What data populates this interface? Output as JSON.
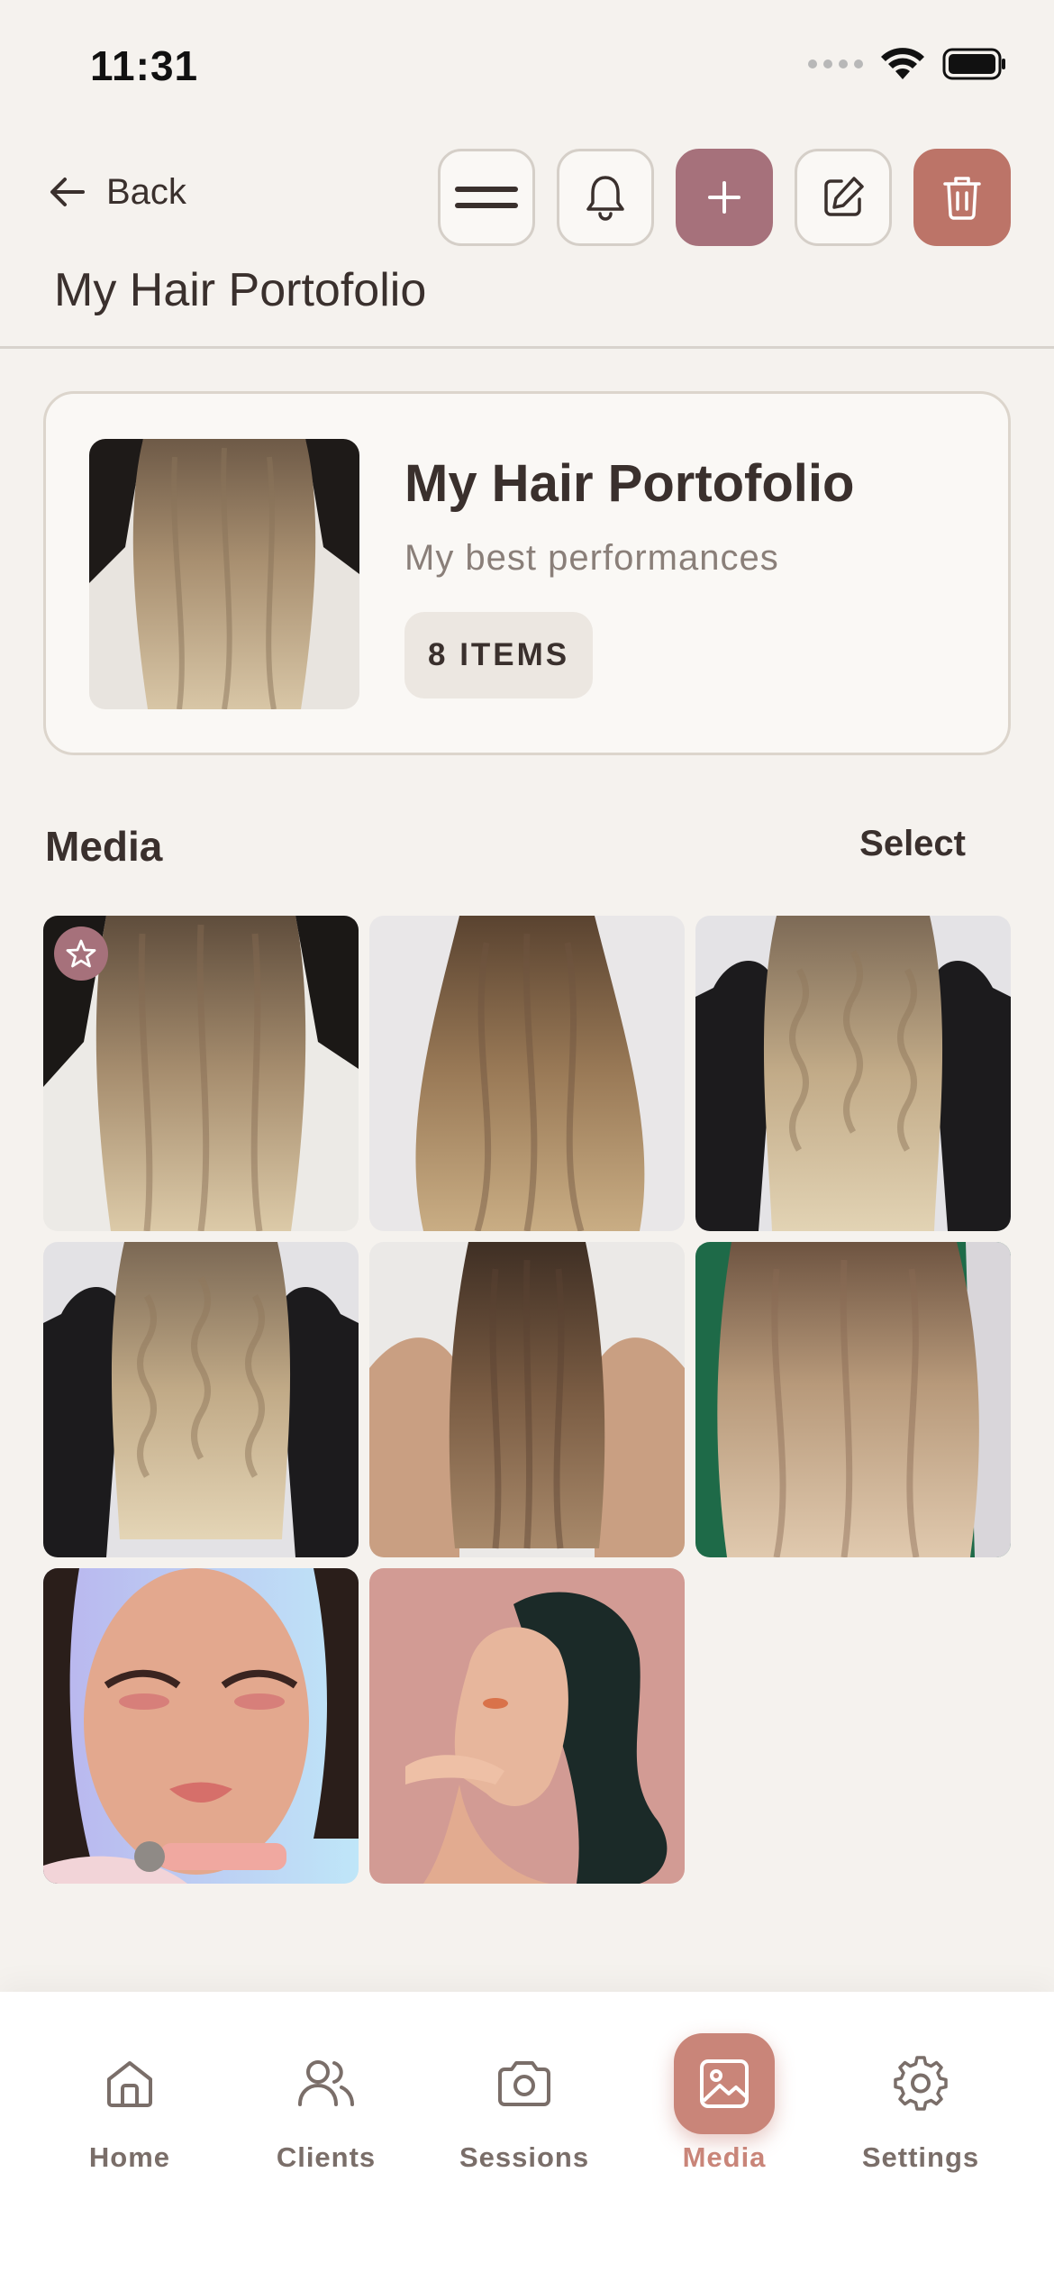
{
  "status_bar": {
    "time": "11:31"
  },
  "header": {
    "back_label": "Back",
    "page_title": "My Hair Portofolio"
  },
  "portfolio": {
    "title": "My Hair Portofolio",
    "subtitle": "My best performances",
    "item_count": "8 ITEMS"
  },
  "media_section": {
    "title": "Media",
    "select_label": "Select",
    "items": [
      {
        "kind": "hair-photo",
        "favorite": true
      },
      {
        "kind": "hair-photo",
        "favorite": false
      },
      {
        "kind": "hair-photo",
        "favorite": false
      },
      {
        "kind": "hair-photo",
        "favorite": false
      },
      {
        "kind": "hair-photo",
        "favorite": false
      },
      {
        "kind": "hair-photo",
        "favorite": false
      },
      {
        "kind": "makeup-photo",
        "favorite": false
      },
      {
        "kind": "portrait-photo",
        "favorite": false
      }
    ]
  },
  "nav": {
    "items": [
      {
        "label": "Home",
        "icon": "home-icon"
      },
      {
        "label": "Clients",
        "icon": "users-icon"
      },
      {
        "label": "Sessions",
        "icon": "camera-icon"
      },
      {
        "label": "Media",
        "icon": "image-icon",
        "active": true
      },
      {
        "label": "Settings",
        "icon": "gear-icon"
      }
    ]
  },
  "colors": {
    "accent_plum": "#a6717b",
    "accent_red": "#bc7468",
    "nav_active": "#c98579",
    "background": "#f5f2ee"
  }
}
